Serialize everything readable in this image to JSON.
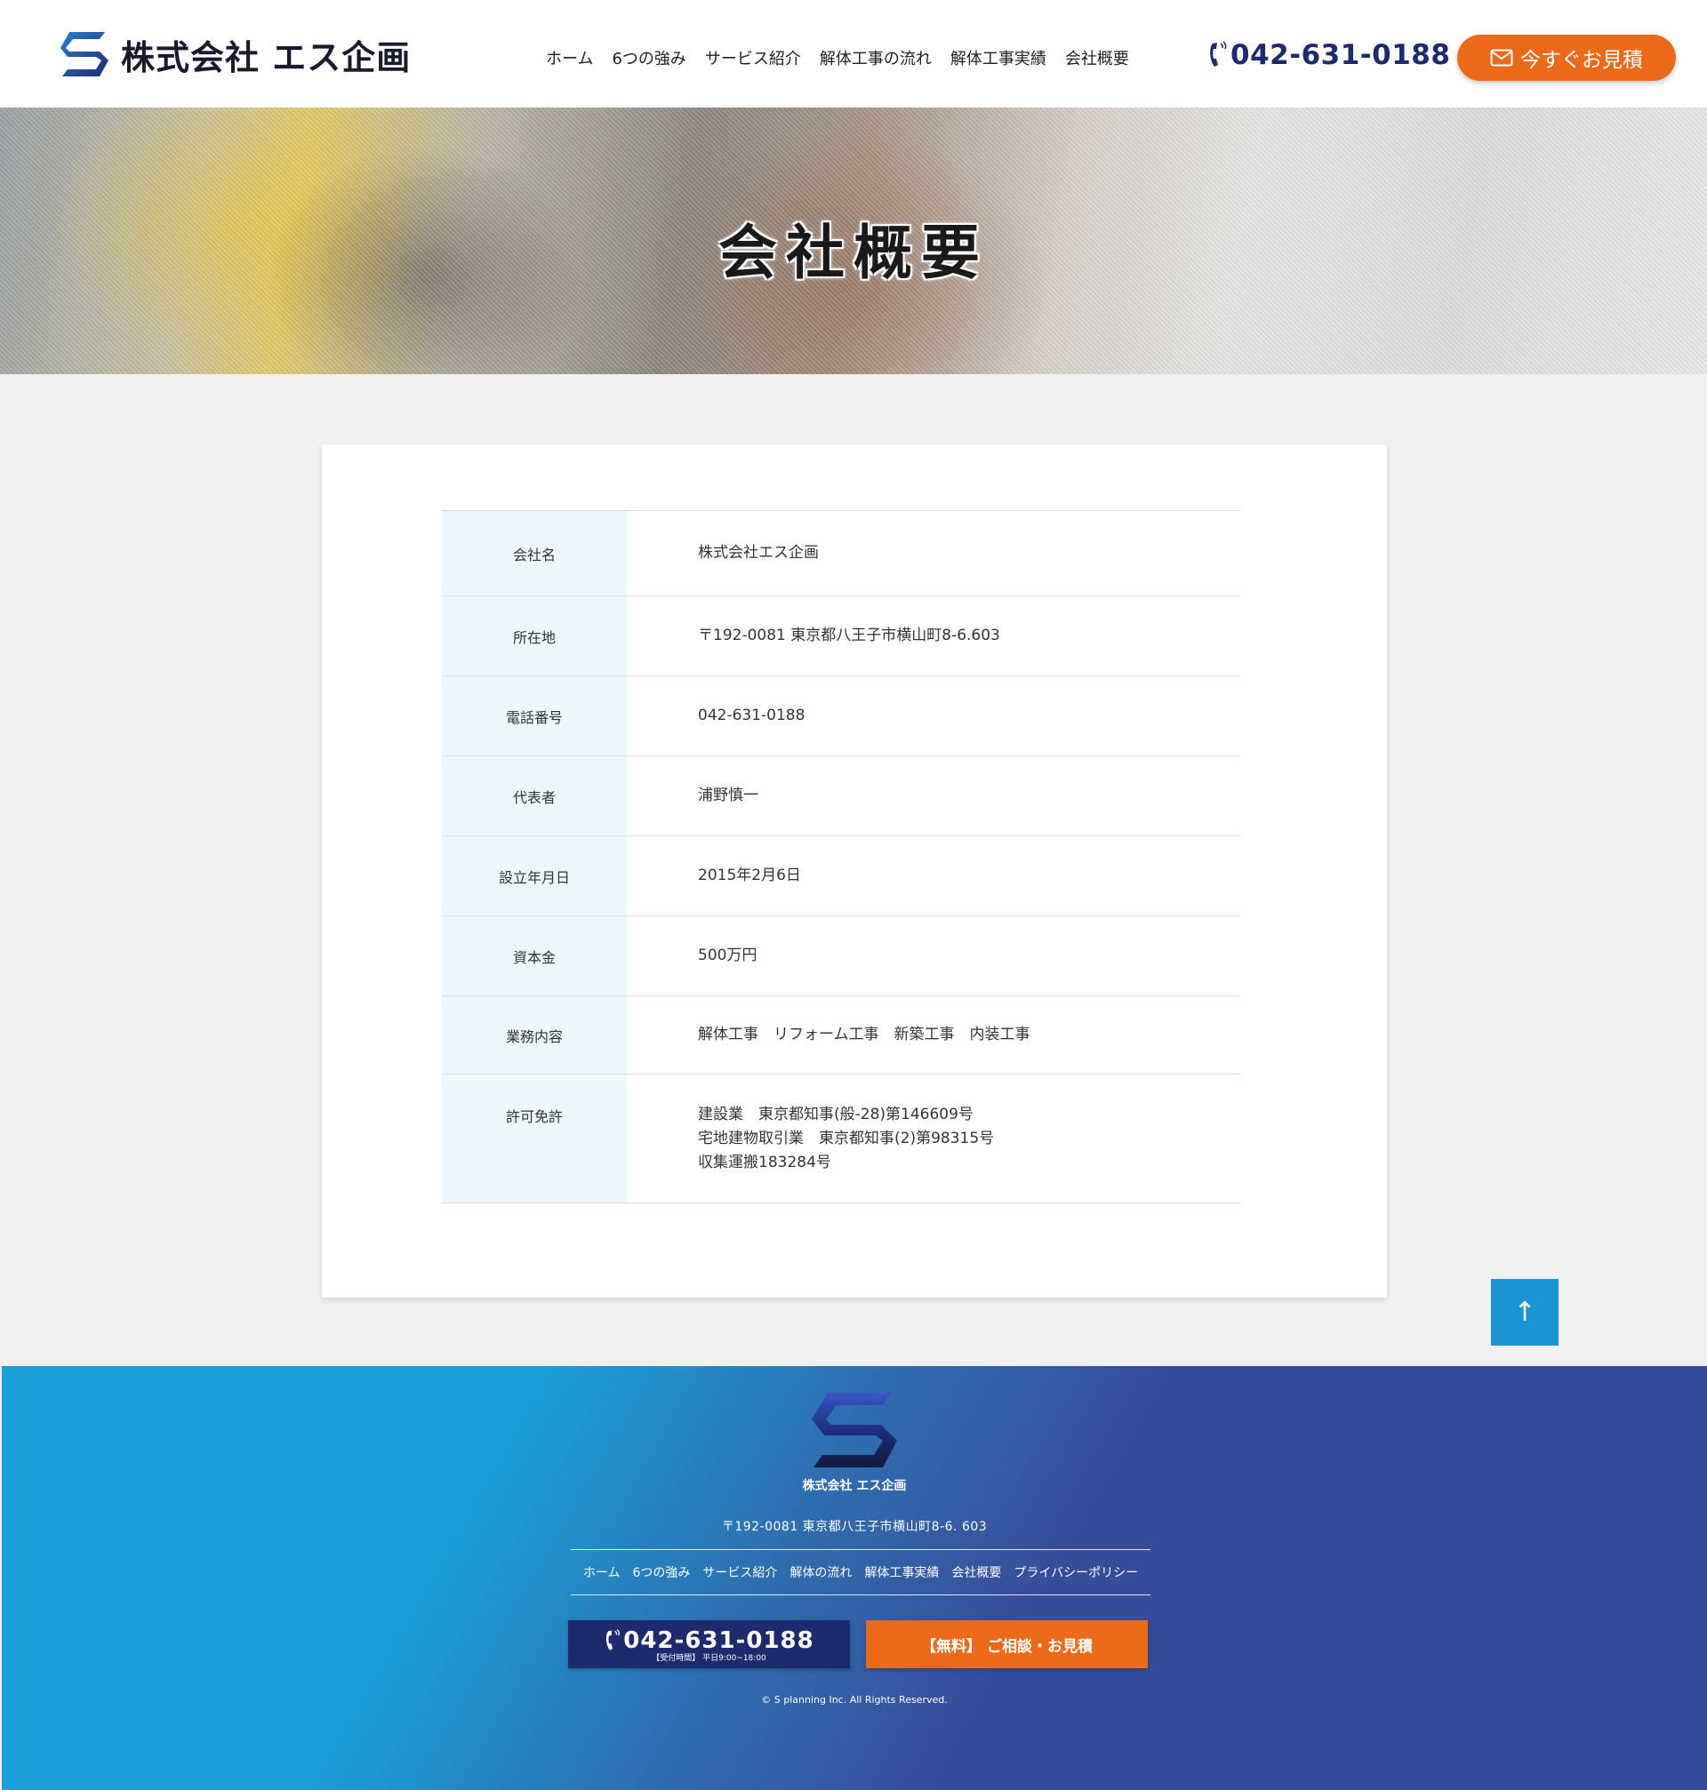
{
  "header": {
    "logo_text": "株式会社 エス企画",
    "nav": [
      "ホーム",
      "6つの強み",
      "サービス紹介",
      "解体工事の流れ",
      "解体工事実績",
      "会社概要"
    ],
    "phone": "042-631-0188",
    "cta_label": "今すぐお見積"
  },
  "hero": {
    "title": "会社概要"
  },
  "company_info": {
    "rows": [
      {
        "label": "会社名",
        "value": "株式会社エス企画"
      },
      {
        "label": "所在地",
        "value": "〒192-0081 東京都八王子市横山町8-6.603"
      },
      {
        "label": "電話番号",
        "value": "042-631-0188"
      },
      {
        "label": "代表者",
        "value": "浦野慎一"
      },
      {
        "label": "設立年月日",
        "value": "2015年2月6日"
      },
      {
        "label": "資本金",
        "value": "500万円"
      },
      {
        "label": "業務内容",
        "value": "解体工事　リフォーム工事　新築工事　内装工事"
      },
      {
        "label": "許可免許",
        "lines": [
          "建設業　東京都知事(般-28)第146609号",
          "宅地建物取引業　東京都知事(2)第98315号",
          "収集運搬183284号"
        ]
      }
    ]
  },
  "to_top": "↑",
  "footer": {
    "company_name": "株式会社 エス企画",
    "address": "〒192-0081 東京都八王子市横山町8-6. 603",
    "nav": [
      "ホーム",
      "6つの強み",
      "サービス紹介",
      "解体の流れ",
      "解体工事実績",
      "会社概要",
      "プライバシーポリシー"
    ],
    "phone": "042-631-0188",
    "hours": "【受付時間】 平日9:00~18:00",
    "contact_label": "【無料】 ご相談・お見積",
    "copyright": "© S planning Inc. All Rights Reserved."
  },
  "colors": {
    "brand_navy": "#1e2a6e",
    "accent_orange": "#ee6a1b",
    "accent_blue": "#1a95d2",
    "table_header_bg": "#ecf6fd"
  },
  "icons": [
    "logo-s-icon",
    "phone-icon",
    "mail-icon",
    "arrow-up-icon"
  ]
}
